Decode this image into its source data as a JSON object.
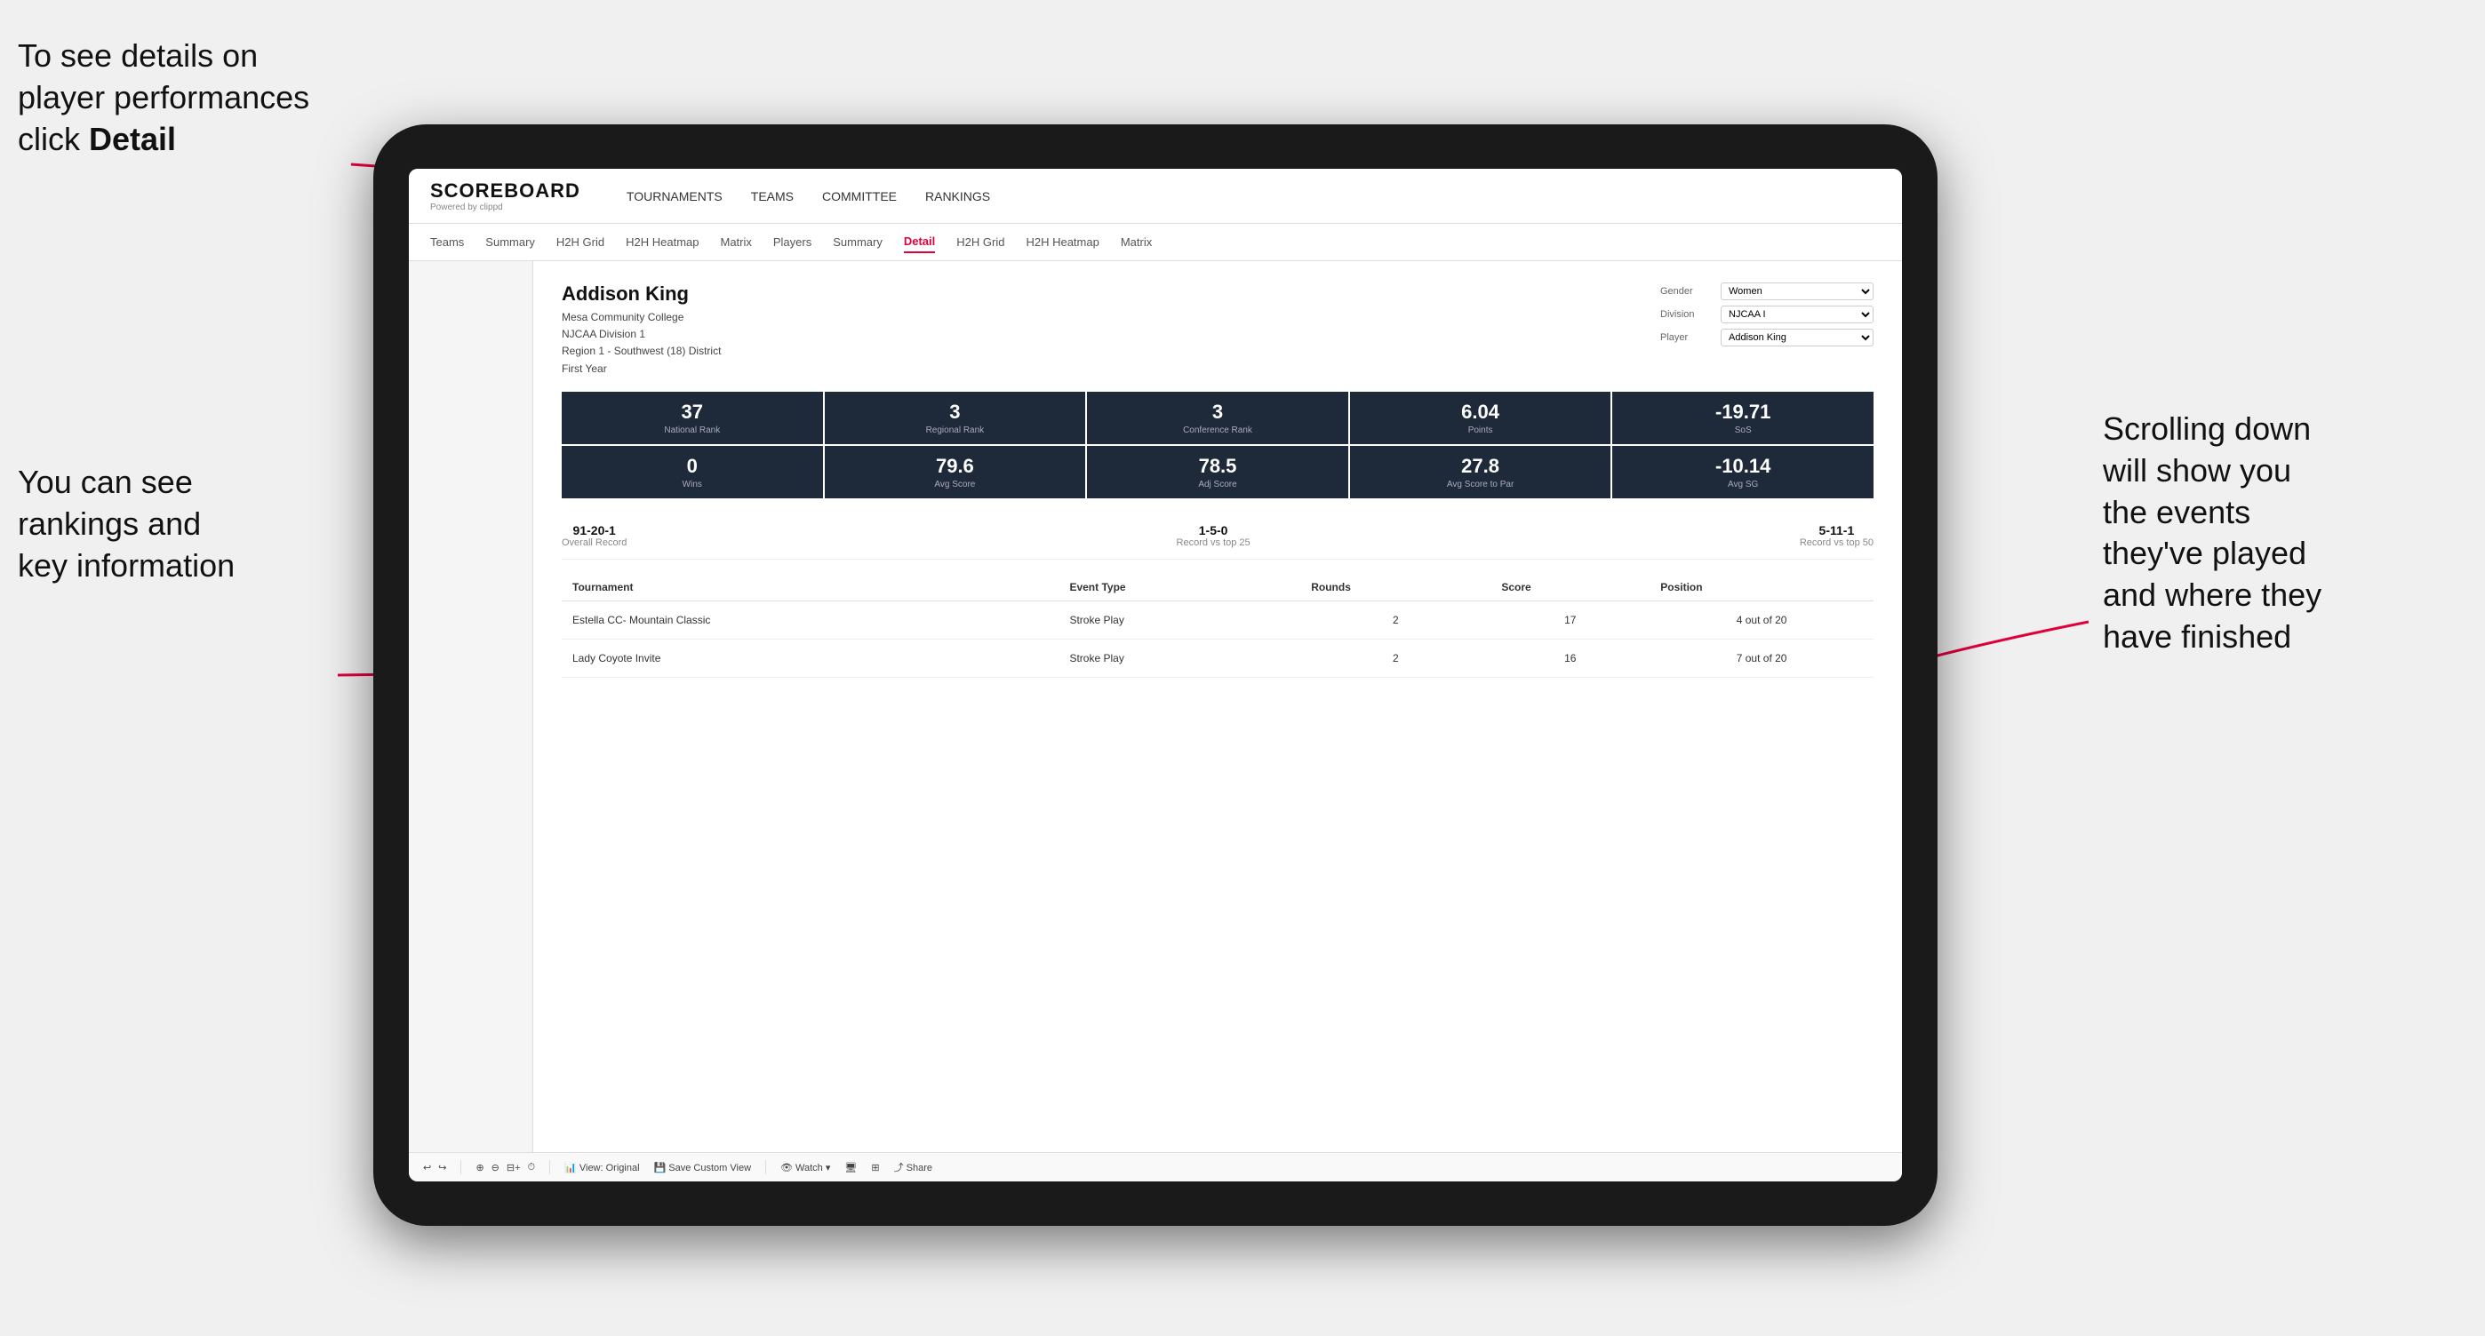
{
  "annotations": {
    "topleft": {
      "line1": "To see details on",
      "line2": "player performances",
      "line3_prefix": "click ",
      "line3_bold": "Detail"
    },
    "bottomleft": {
      "line1": "You can see",
      "line2": "rankings and",
      "line3": "key information"
    },
    "right": {
      "line1": "Scrolling down",
      "line2": "will show you",
      "line3": "the events",
      "line4": "they've played",
      "line5": "and where they",
      "line6": "have finished"
    }
  },
  "nav": {
    "logo_main": "SCOREBOARD",
    "logo_sub": "Powered by clippd",
    "items": [
      "TOURNAMENTS",
      "TEAMS",
      "COMMITTEE",
      "RANKINGS"
    ]
  },
  "subnav": {
    "items": [
      "Teams",
      "Summary",
      "H2H Grid",
      "H2H Heatmap",
      "Matrix",
      "Players",
      "Summary",
      "Detail",
      "H2H Grid",
      "H2H Heatmap",
      "Matrix"
    ],
    "active_index": 7
  },
  "player": {
    "name": "Addison King",
    "school": "Mesa Community College",
    "division": "NJCAA Division 1",
    "region": "Region 1 - Southwest (18) District",
    "year": "First Year"
  },
  "controls": {
    "gender_label": "Gender",
    "gender_value": "Women",
    "division_label": "Division",
    "division_value": "NJCAA I",
    "player_label": "Player",
    "player_value": "Addison King"
  },
  "stats_row1": [
    {
      "value": "37",
      "label": "National Rank"
    },
    {
      "value": "3",
      "label": "Regional Rank"
    },
    {
      "value": "3",
      "label": "Conference Rank"
    },
    {
      "value": "6.04",
      "label": "Points"
    },
    {
      "value": "-19.71",
      "label": "SoS"
    }
  ],
  "stats_row2": [
    {
      "value": "0",
      "label": "Wins"
    },
    {
      "value": "79.6",
      "label": "Avg Score"
    },
    {
      "value": "78.5",
      "label": "Adj Score"
    },
    {
      "value": "27.8",
      "label": "Avg Score to Par"
    },
    {
      "value": "-10.14",
      "label": "Avg SG"
    }
  ],
  "records": [
    {
      "value": "91-20-1",
      "label": "Overall Record"
    },
    {
      "value": "1-5-0",
      "label": "Record vs top 25"
    },
    {
      "value": "5-11-1",
      "label": "Record vs top 50"
    }
  ],
  "table": {
    "headers": [
      "Tournament",
      "Event Type",
      "Rounds",
      "Score",
      "Position"
    ],
    "rows": [
      {
        "tournament": "Estella CC- Mountain Classic",
        "event_type": "Stroke Play",
        "rounds": "2",
        "score": "17",
        "position": "4 out of 20"
      },
      {
        "tournament": "Lady Coyote Invite",
        "event_type": "Stroke Play",
        "rounds": "2",
        "score": "16",
        "position": "7 out of 20"
      }
    ]
  },
  "toolbar": {
    "items": [
      "↩",
      "↪",
      "⊕",
      "⊕",
      "—+",
      "⏱",
      "View: Original",
      "Save Custom View",
      "Watch ▾",
      "🖥",
      "⊞",
      "Share"
    ]
  }
}
